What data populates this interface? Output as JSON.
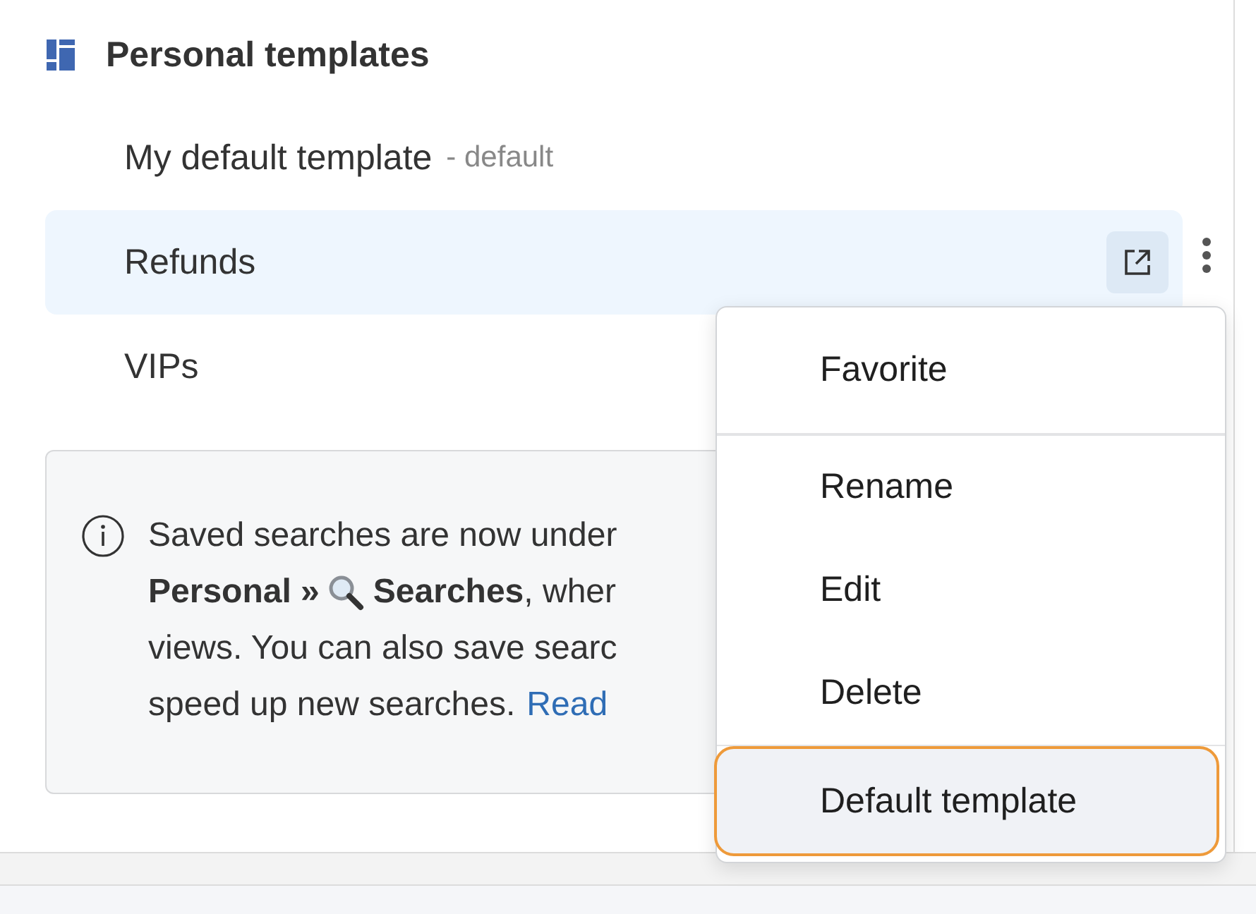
{
  "section": {
    "title": "Personal templates"
  },
  "templates": [
    {
      "name": "My default template",
      "suffix": "- default",
      "selected": false
    },
    {
      "name": "Refunds",
      "selected": true
    },
    {
      "name": "VIPs",
      "selected": false
    }
  ],
  "info": {
    "line_1": "Saved searches are now under",
    "line_2_start": "Personal »",
    "line_2_end": "**Searches**, wher",
    "line_3": "views. You can also save searc",
    "line_4": "speed up new searches.",
    "link": "Read"
  },
  "menu": {
    "items": [
      {
        "label": "Favorite",
        "selected": false,
        "divider_after": true
      },
      {
        "label": "Rename",
        "selected": false,
        "divider_after": false
      },
      {
        "label": "Edit",
        "selected": false,
        "divider_after": false
      },
      {
        "label": "Delete",
        "selected": false,
        "divider_after": true
      },
      {
        "label": "Default template",
        "selected": true,
        "divider_after": false
      }
    ]
  }
}
